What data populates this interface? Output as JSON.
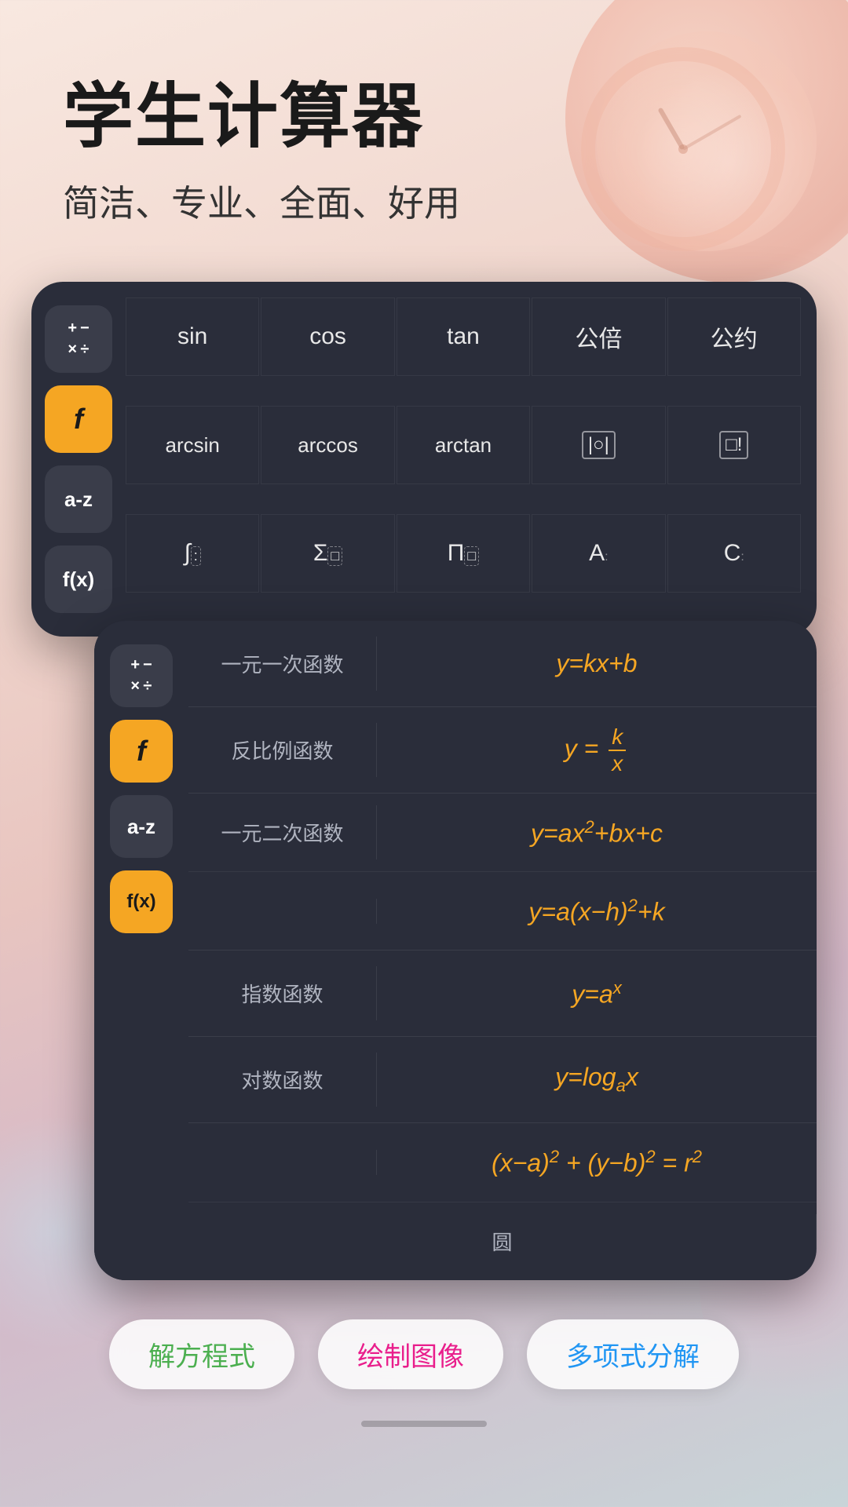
{
  "header": {
    "title": "学生计算器",
    "subtitle": "简洁、专业、全面、好用"
  },
  "sidebar_back": {
    "btn_ops_label": "×÷",
    "btn_f_label": "f",
    "btn_az_label": "a-z",
    "btn_fx_label": "f(x)"
  },
  "trig_panel": {
    "row1": [
      "sin",
      "cos",
      "tan",
      "公倍",
      "公约"
    ],
    "row2": [
      "arcsin",
      "arccos",
      "arctan",
      "|○|",
      "□!"
    ],
    "row3": [
      "∫:",
      "Σ□",
      "Π□",
      "A:",
      "C:"
    ]
  },
  "sidebar_front": {
    "btn_ops_label": "×÷",
    "btn_f_label": "f",
    "btn_az_label": "a-z",
    "btn_fx_label": "f(x)"
  },
  "func_list": [
    {
      "name": "一元一次函数",
      "formula": "y=kx+b"
    },
    {
      "name": "反比例函数",
      "formula": "y=k/x"
    },
    {
      "name": "一元二次函数",
      "formula1": "y=ax²+bx+c",
      "formula2": "y=a(x-h)²+k"
    },
    {
      "name": "指数函数",
      "formula": "y=aˣ"
    },
    {
      "name": "对数函数",
      "formula": "y=logₐx"
    },
    {
      "name": "圆",
      "formula": "(x-a)²+(y-b)²=r²"
    }
  ],
  "bottom_buttons": [
    {
      "label": "解方程式",
      "color_class": "pill-green"
    },
    {
      "label": "绘制图像",
      "color_class": "pill-pink"
    },
    {
      "label": "多项式分解",
      "color_class": "pill-blue"
    }
  ]
}
